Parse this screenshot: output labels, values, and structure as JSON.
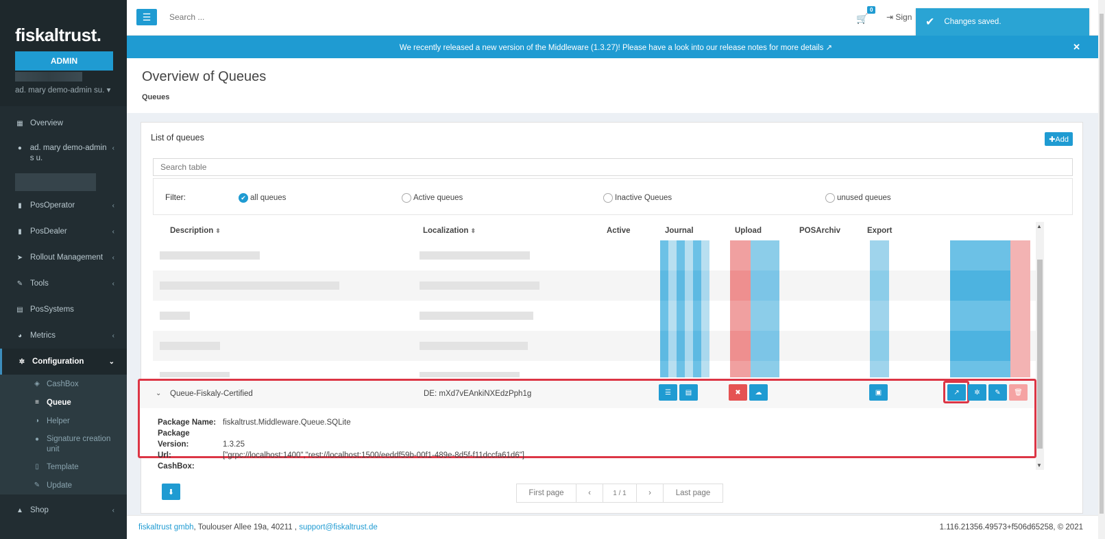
{
  "sidebar": {
    "logo": "fiskaltrust.",
    "admin_label": "ADMIN",
    "user_label": "ad. mary demo-admin su. ▾",
    "items": [
      {
        "label": "Overview",
        "icon": "dashboard-icon"
      },
      {
        "label": "ad. mary demo-admin s u.",
        "icon": "user-icon"
      },
      {
        "label": "PosOperator",
        "icon": "building-icon"
      },
      {
        "label": "PosDealer",
        "icon": "building-icon"
      },
      {
        "label": "Rollout Management",
        "icon": "rocket-icon"
      },
      {
        "label": "Tools",
        "icon": "wrench-icon"
      },
      {
        "label": "PosSystems",
        "icon": "cashregister-icon"
      },
      {
        "label": "Metrics",
        "icon": "piechart-icon"
      },
      {
        "label": "Configuration",
        "icon": "gears-icon"
      },
      {
        "label": "Shop",
        "icon": "cart-icon"
      }
    ],
    "submenu": [
      {
        "label": "CashBox",
        "icon": "cube-icon"
      },
      {
        "label": "Queue",
        "icon": "database-icon"
      },
      {
        "label": "Helper",
        "icon": "halfcircle-icon"
      },
      {
        "label": "Signature creation unit",
        "icon": "circle-icon"
      },
      {
        "label": "Template",
        "icon": "file-icon"
      },
      {
        "label": "Update",
        "icon": "wrench-icon"
      }
    ]
  },
  "topbar": {
    "search_placeholder": "Search ...",
    "cart_count": "0",
    "sign_label": "Sign"
  },
  "toast": {
    "message": "Changes saved."
  },
  "announcement": {
    "text": "We recently released a new version of the Middleware (1.3.27)! Please have a look into our release notes for more details ↗"
  },
  "header": {
    "title": "Overview of Queues",
    "breadcrumb": "Queues"
  },
  "box": {
    "title": "List of queues",
    "add_label": "✚Add",
    "search_placeholder": "Search table",
    "filter_label": "Filter:",
    "filters": [
      "all queues",
      "Active queues",
      "Inactive Queues",
      "unused queues"
    ],
    "selected_filter": "all queues"
  },
  "table": {
    "columns": [
      "Description",
      "Localization",
      "Active",
      "Journal",
      "Upload",
      "POSArchiv",
      "Export"
    ]
  },
  "expanded": {
    "description": "Queue-Fiskaly-Certified",
    "localization": "DE: mXd7vEAnkiNXEdzPph1g",
    "details": [
      {
        "key": "Package Name:",
        "value": "fiskaltrust.Middleware.Queue.SQLite"
      },
      {
        "key": "Package Version:",
        "value": "1.3.25"
      },
      {
        "key": "Url:",
        "value": "[\"grpc://localhost:1400\",\"rest://localhost:1500/eeddf59b-00f1-489e-8d5f-f11dccfa61d6\"]"
      },
      {
        "key": "CashBox:",
        "value": ""
      }
    ]
  },
  "pagination": {
    "first": "First page",
    "prev": "‹",
    "current": "1 / 1",
    "next": "›",
    "last": "Last page"
  },
  "footer": {
    "company": "fiskaltrust gmbh",
    "address": ", Toulouser Allee 19a, 40211 , ",
    "email": "support@fiskaltrust.de",
    "version": "1.116.21356.49573+f506d65258, © 2021"
  }
}
